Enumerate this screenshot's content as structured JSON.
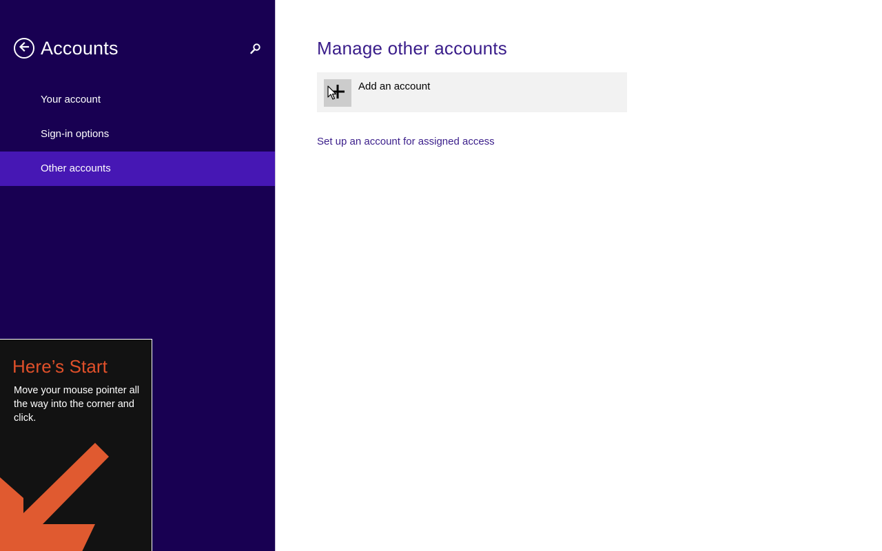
{
  "sidebar": {
    "title": "Accounts",
    "back_icon": "back-arrow-icon",
    "search_icon": "search-icon",
    "items": [
      {
        "label": "Your account",
        "selected": false
      },
      {
        "label": "Sign-in options",
        "selected": false
      },
      {
        "label": "Other accounts",
        "selected": true
      }
    ],
    "colors": {
      "background": "#180052",
      "selected": "#4617b4"
    }
  },
  "main": {
    "title": "Manage other accounts",
    "add_account": {
      "label": "Add an account",
      "icon": "plus-icon"
    },
    "assigned_access_link": "Set up an account for assigned access",
    "colors": {
      "accent": "#3a1d8a"
    }
  },
  "start_tip": {
    "title": "Here’s Start",
    "body": "Move your mouse pointer all the way into the corner and click.",
    "arrow_icon": "arrow-down-left-icon",
    "colors": {
      "title": "#e0502a",
      "arrow": "#e05a30"
    }
  }
}
